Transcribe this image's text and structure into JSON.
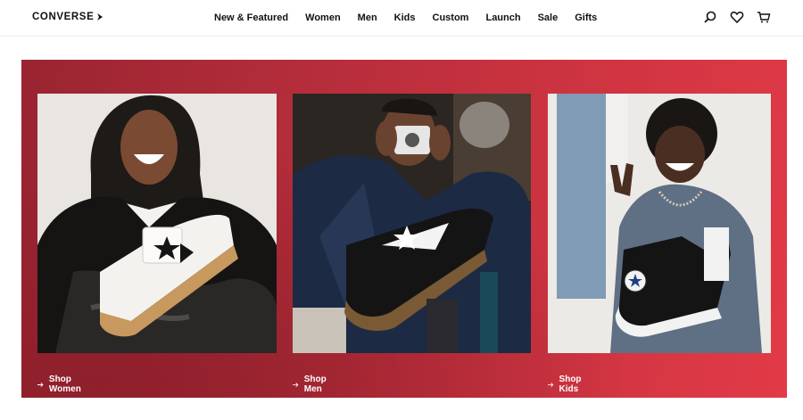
{
  "brand": {
    "logo_text": "CONVERSE"
  },
  "nav": {
    "items": [
      "New & Featured",
      "Women",
      "Men",
      "Kids",
      "Custom",
      "Launch",
      "Sale",
      "Gifts"
    ]
  },
  "header_icons": [
    "search-icon",
    "heart-icon",
    "cart-icon"
  ],
  "hero": {
    "colors": {
      "primary": "#b12c3a",
      "accent": "#e23a47"
    },
    "cards": [
      {
        "link_label": "Shop Women",
        "image": "woman-laughing-holding-white-sneaker"
      },
      {
        "link_label": "Shop Men",
        "image": "man-with-camera-holding-black-low-top-sneaker"
      },
      {
        "link_label": "Shop Kids",
        "image": "child-peace-sign-holding-black-high-top-chuck"
      }
    ]
  }
}
